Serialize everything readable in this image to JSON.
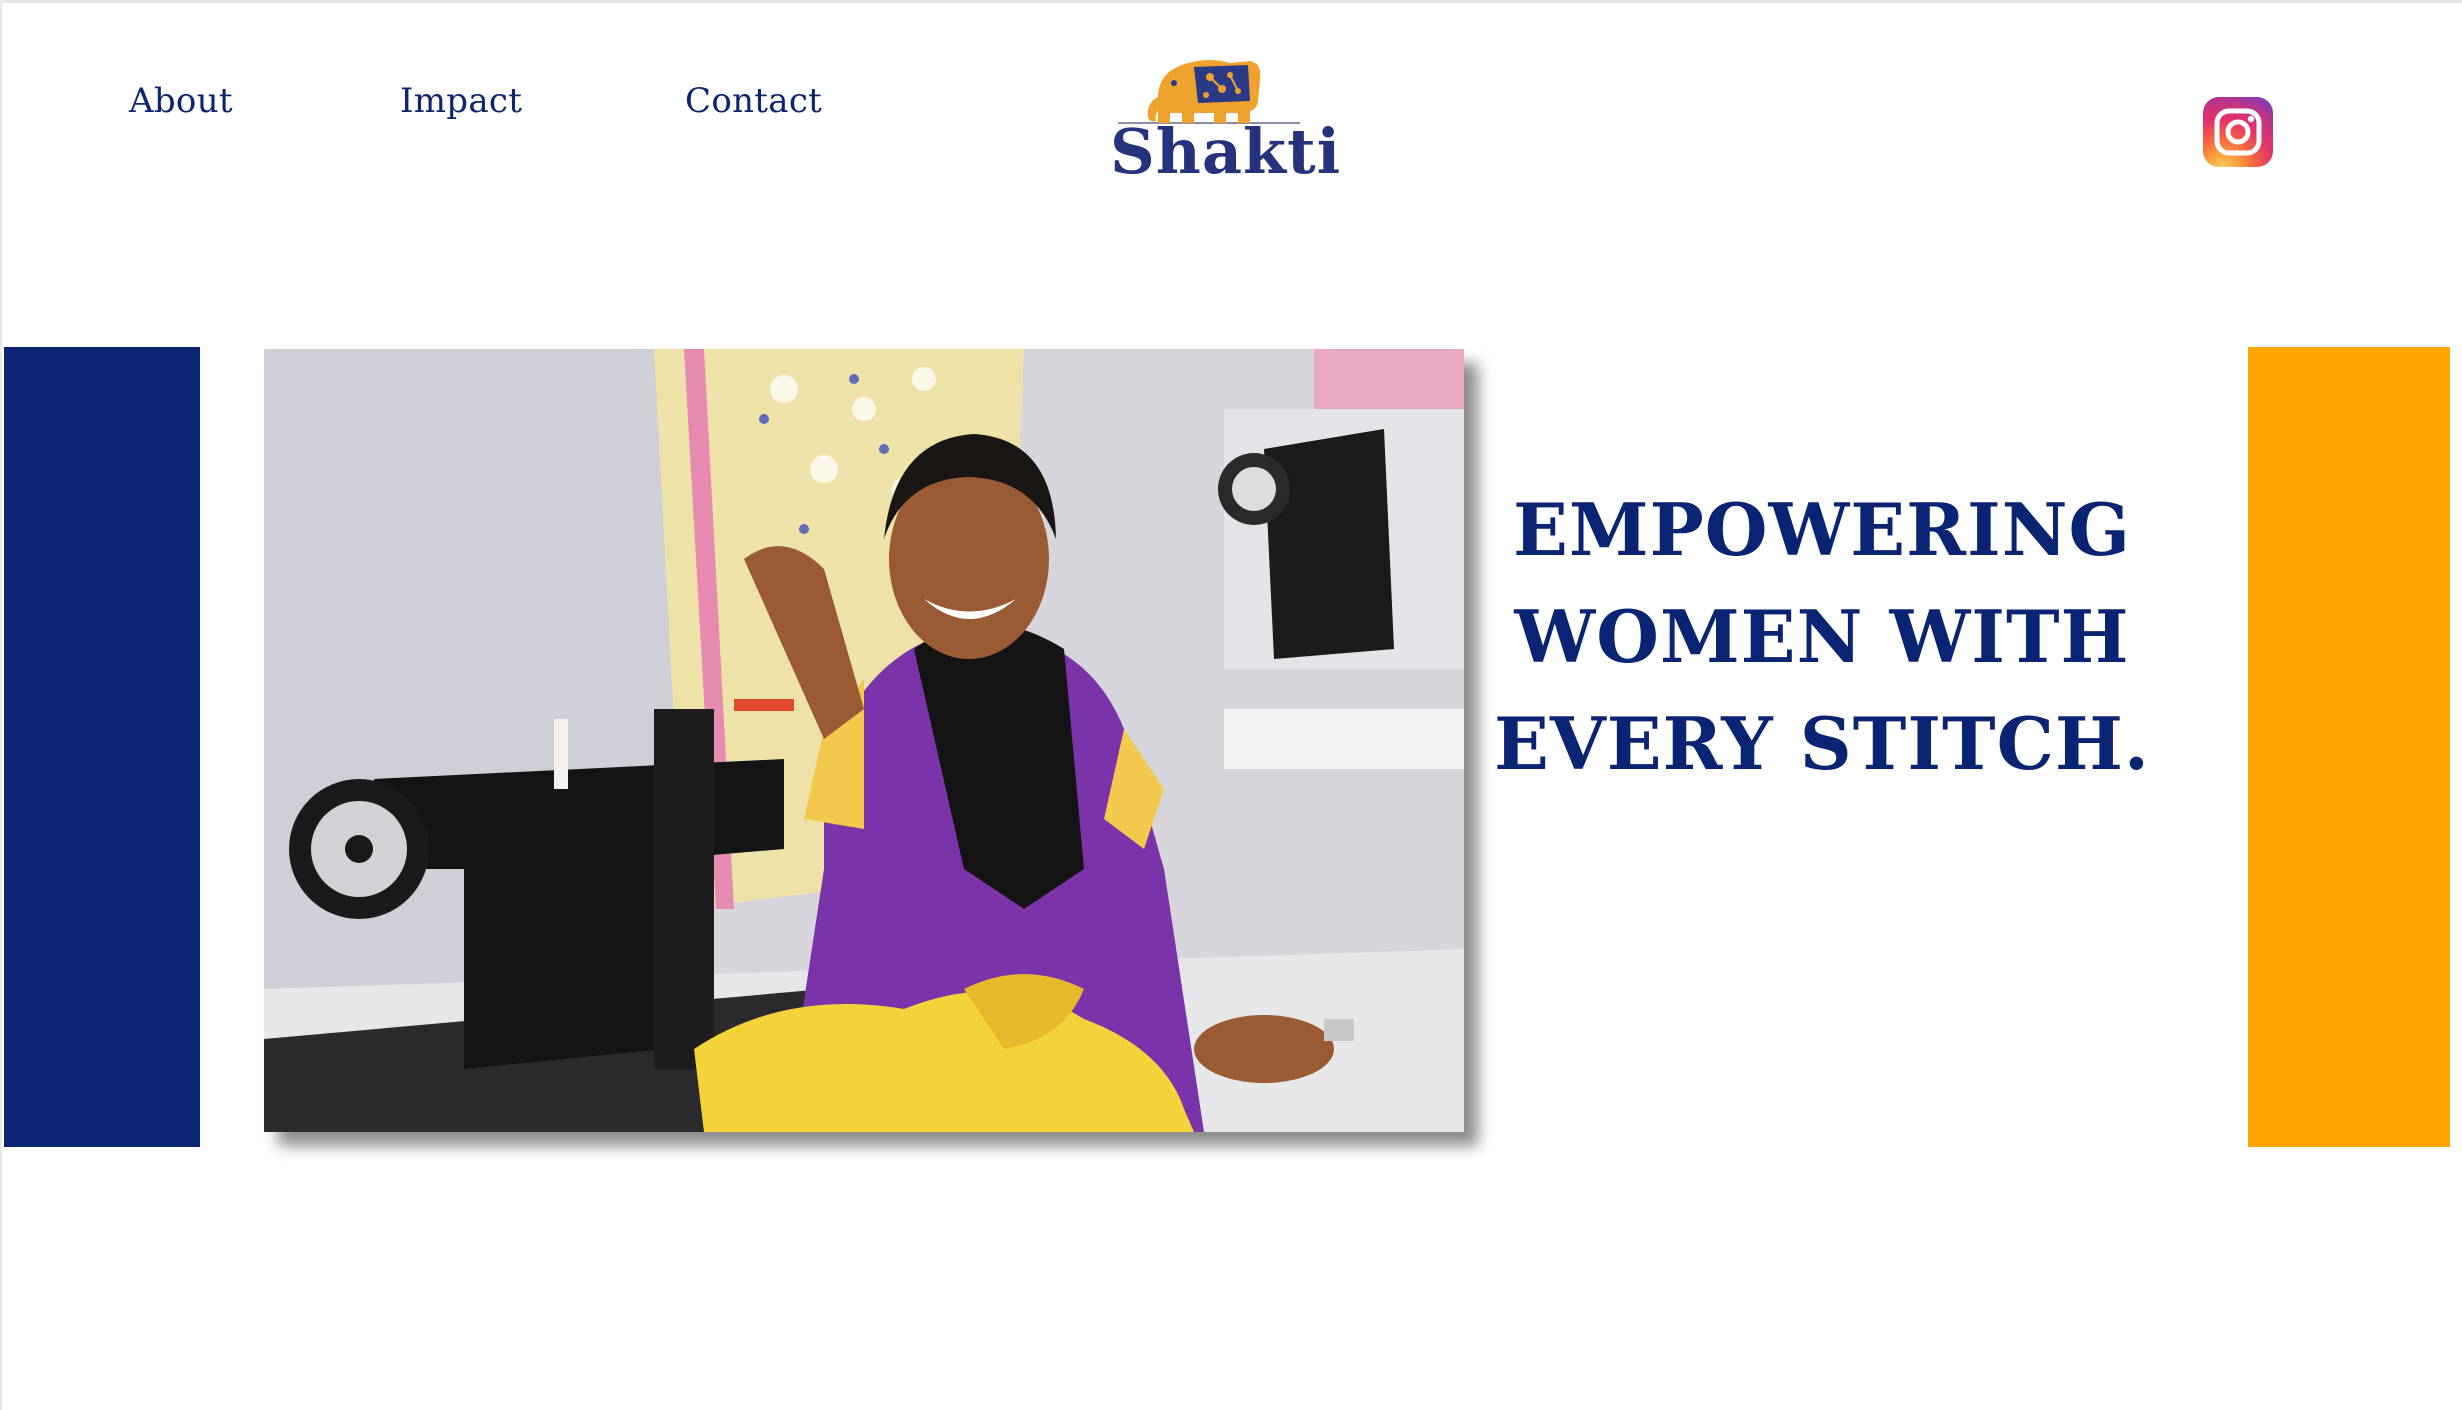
{
  "header": {
    "nav": [
      {
        "label": "About"
      },
      {
        "label": "Impact"
      },
      {
        "label": "Contact"
      }
    ],
    "logo_text": "Shakti",
    "social_icon": "instagram-icon"
  },
  "hero": {
    "headline_lines": [
      "EMPOWERING",
      "WOMEN WITH",
      "EVERY STITCH."
    ],
    "photo_subject": "woman-sewing-photo"
  },
  "colors": {
    "brand_navy": "#0a2473",
    "brand_orange": "#ffa403",
    "logo_elephant": "#f0a22e",
    "text_nav": "#0d2470"
  }
}
